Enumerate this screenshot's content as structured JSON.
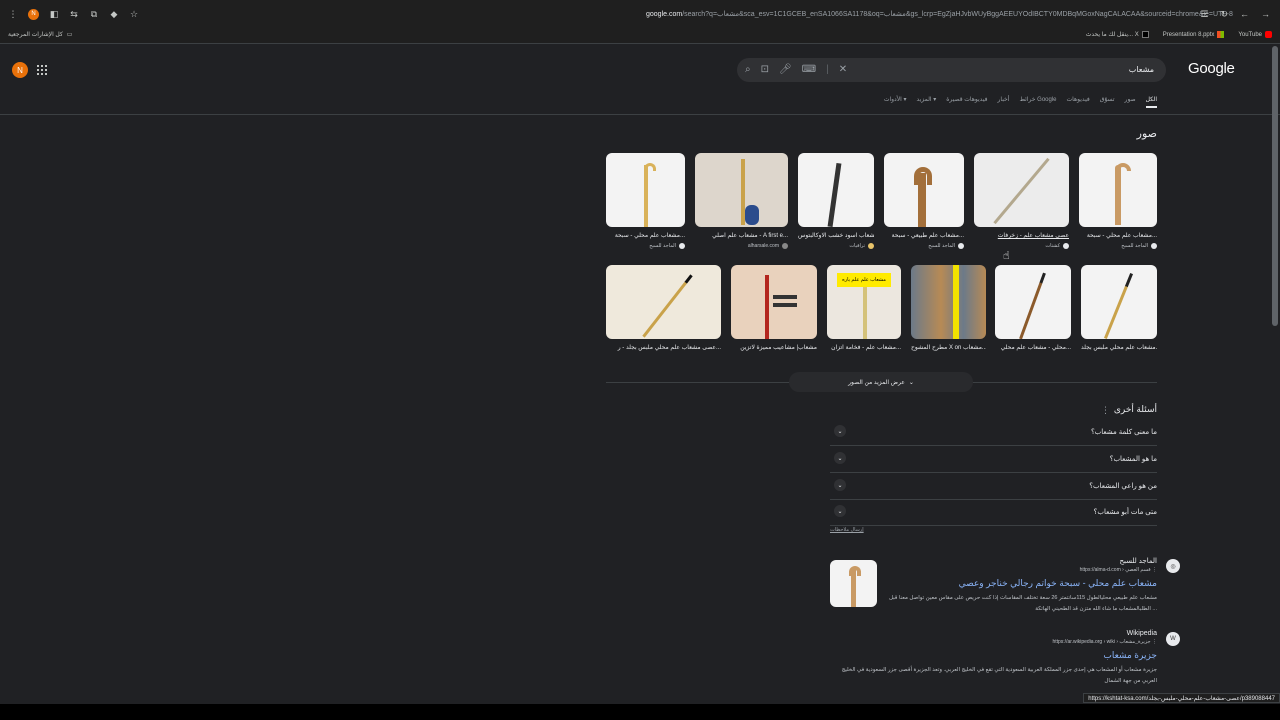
{
  "browser": {
    "url_host": "google.com",
    "url_rest": "/search?q=مشعاب&sca_esv=1C1GCEB_enSA1066SA1178&oq=مشعاب&gs_lcrp=EgZjaHJvbWUyBggAEEUYOdIBCTY0MDBqMGoxNagCALACAA&sourceid=chrome&ie=UTF-8",
    "tab_avatar": "N",
    "bookmarks_left": "كل الإشارات المرجعية",
    "bookmarks": [
      "YouTube",
      "Presentation 8.pptx",
      "ينقل لك ما يحدث... X"
    ],
    "status_url": "https://kshtat-ksa.com/عصى-مشعاب-علم-محلي-ملبس-بجلد/p389088447"
  },
  "google": {
    "logo": "Google",
    "query": "مشعاب",
    "avatar_letter": "N",
    "tabs": [
      "الكل",
      "صور",
      "تسوّق",
      "فيديوهات",
      "خرائط Google",
      "أخبار",
      "فيديوهات قصيرة",
      "المزيد",
      "الأدوات"
    ],
    "images_heading": "صور",
    "images_row1": [
      {
        "caption": "مشعاب علم محلي - سبحة...",
        "source": "الماجد للسبح"
      },
      {
        "caption": "عصى مشعاب علم - زخرفات",
        "source": "كشتات"
      },
      {
        "caption": "مشعاب علم طبيعي - سبحة...",
        "source": "الماجد للسبح"
      },
      {
        "caption": "مشعاب اسود خشب الاوكالبتوس",
        "source": "ترافيات"
      },
      {
        "caption": "مشعاب علم اصلي - A first e...",
        "source": "alharsale.com"
      },
      {
        "caption": "مشعاب علم محلي - سبحة...",
        "source": "الماجد للسبح"
      }
    ],
    "images_row2": [
      {
        "caption": "مشعاب علم محلي ملبس بجلد..."
      },
      {
        "caption": "محلي - مشعاب علم محلي..."
      },
      {
        "caption": "مطرح المشوح X on مشعاب..."
      },
      {
        "caption": "مشعاب علم - فخامة اتزان..."
      },
      {
        "caption": "مشعاب| مشاعيب مميزة لاتزين"
      },
      {
        "caption": "عصى مشعاب علم محلي ملبس بجلد - ر..."
      }
    ],
    "sticker_label": "مشعاب علم علم ياره",
    "more_images": "عرض المزيد من الصور",
    "paa_title": "أسئلة أخرى",
    "paa": [
      "ما معنى كلمة مشعاب؟",
      "ما هو المشعاب؟",
      "من هو راعي المشعاب؟",
      "متى مات أبو مشعاب؟"
    ],
    "feedback": "إرسال ملاحظات",
    "results": [
      {
        "site": "الماجد للسبح",
        "crumb": "https://alma-d.com › قسم العصي",
        "title": "مشعاب علم محلي - سبحة خواتم رجالي خناجر وعصي",
        "snippet": "مشعاب علم طبيعي محليالطول 115سانتمتر 26 سعة تختلف المقاسات إذا كنت حريص على مقاس معين تواصل معنا قبل الطلبالمشعاب ما شاء الله متزن قد الطحيني الهاتكة ..."
      },
      {
        "site": "Wikipedia",
        "crumb": "https://ar.wikipedia.org › wiki › جزيرة_مشعاب",
        "title": "جزيرة مشعاب",
        "snippet": "جزيرة مشعاب أو المشعاب هي إحدى جزر المملكة العربية السعودية التي تقع في الخليج العربي. وتعد الجزيرة أقصى جزر السعودية في الخليج العربي من جهة الشمال"
      }
    ]
  }
}
